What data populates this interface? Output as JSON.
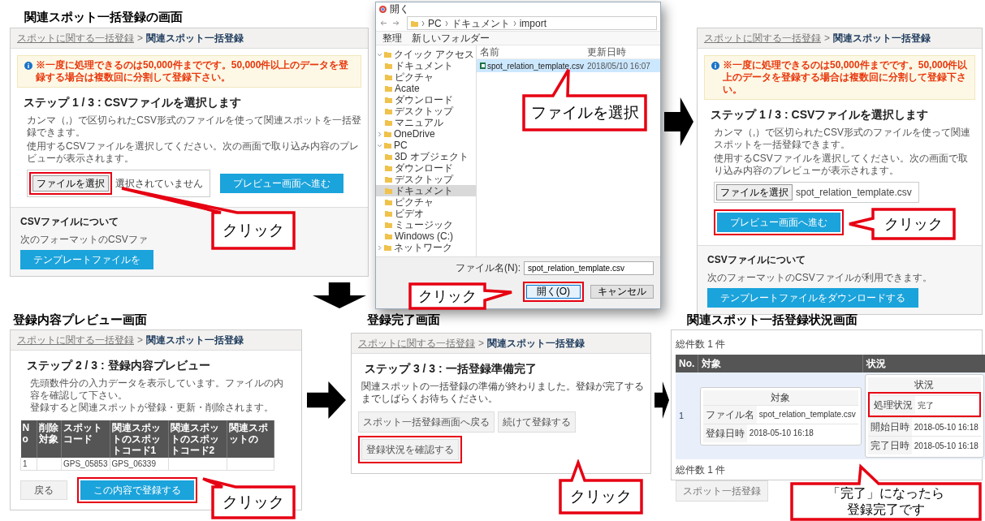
{
  "screen_select": {
    "title": "関連スポット一括登録の画面",
    "breadcrumb": {
      "parent": "スポットに関する一括登録",
      "separator": ">",
      "current": "関連スポット一括登録"
    },
    "notice": "※一度に処理できるのは50,000件までです。50,000件以上のデータを登録する場合は複数回に分割して登録下さい。",
    "heading": "ステップ 1 / 3 : CSVファイルを選択します",
    "description": [
      "カンマ（,）で区切られたCSV形式のファイルを使って関連スポットを一括登録できます。",
      "使用するCSVファイルを選択してください。次の画面で取り込み内容のプレビューが表示されます。"
    ],
    "file_button": {
      "label": "ファイルを選択",
      "highlighted": true
    },
    "file_status": "選択されていません",
    "preview_button": {
      "label": "プレビュー画面へ進む",
      "highlighted": false
    },
    "csv_section": {
      "heading": "CSVファイルについて",
      "text": "次のフォーマットのCSVファ",
      "button": "テンプレートファイルを"
    },
    "callout": "クリック"
  },
  "file_dialog": {
    "title": "開く",
    "path": [
      "PC",
      "ドキュメント",
      "import"
    ],
    "toolbar": [
      "整理",
      "新しいフォルダー"
    ],
    "sidebar": [
      {
        "label": "クイック アクセス",
        "expanded": true,
        "selected": false,
        "children": [
          {
            "label": "ドキュメント",
            "selected": false
          },
          {
            "label": "ピクチャ",
            "selected": false
          },
          {
            "label": "Acate",
            "selected": false
          },
          {
            "label": "ダウンロード",
            "selected": false
          },
          {
            "label": "デスクトップ",
            "selected": false
          },
          {
            "label": "マニュアル",
            "selected": false
          }
        ]
      },
      {
        "label": "OneDrive",
        "expanded": false,
        "selected": false
      },
      {
        "label": "PC",
        "expanded": true,
        "selected": false,
        "children": [
          {
            "label": "3D オブジェクト",
            "selected": false
          },
          {
            "label": "ダウンロード",
            "selected": false
          },
          {
            "label": "デスクトップ",
            "selected": false
          },
          {
            "label": "ドキュメント",
            "selected": true
          },
          {
            "label": "ピクチャ",
            "selected": false
          },
          {
            "label": "ビデオ",
            "selected": false
          },
          {
            "label": "ミュージック",
            "selected": false
          },
          {
            "label": "Windows (C:)",
            "selected": false
          }
        ]
      },
      {
        "label": "ネットワーク",
        "expanded": false,
        "selected": false
      }
    ],
    "columns": [
      "名前",
      "更新日時"
    ],
    "files": [
      {
        "name": "spot_relation_template.csv",
        "modified": "2018/05/10 16:07",
        "selected": true
      }
    ],
    "file_name_label": "ファイル名(N):",
    "file_name": "spot_relation_template.csv",
    "open_button": {
      "label": "開く(O)",
      "highlighted": true
    },
    "cancel_button": "キャンセル",
    "callout_select": "ファイルを選択",
    "callout_click": "クリック"
  },
  "screen_selected": {
    "breadcrumb": {
      "parent": "スポットに関する一括登録",
      "separator": ">",
      "current": "関連スポット一括登録"
    },
    "notice": "※一度に処理できるのは50,000件までです。50,000件以上のデータを登録する場合は複数回に分割して登録下さい。",
    "heading": "ステップ 1 / 3 : CSVファイルを選択します",
    "description": [
      "カンマ（,）で区切られたCSV形式のファイルを使って関連スポットを一括登録できます。",
      "使用するCSVファイルを選択してください。次の画面で取り込み内容のプレビューが表示されます。"
    ],
    "file_button": {
      "label": "ファイルを選択",
      "highlighted": false
    },
    "file_status": "spot_relation_template.csv",
    "preview_button": {
      "label": "プレビュー画面へ進む",
      "highlighted": true
    },
    "csv_section": {
      "heading": "CSVファイルについて",
      "text": "次のフォーマットのCSVファイルが利用できます。",
      "button": "テンプレートファイルをダウンロードする"
    },
    "callout": "クリック"
  },
  "screen_preview": {
    "title": "登録内容プレビュー画面",
    "breadcrumb": {
      "parent": "スポットに関する一括登録",
      "separator": ">",
      "current": "関連スポット一括登録"
    },
    "heading": "ステップ 2 / 3 : 登録内容プレビュー",
    "description": [
      "先頭数件分の入力データを表示しています。ファイルの内容を確認して下さい。",
      "登録すると関連スポットが登録・更新・削除されます。"
    ],
    "table": {
      "columns": [
        "No",
        "削除対象",
        "スポットコード",
        "関連スポットのスポットコード1",
        "関連スポットのスポットコード2",
        "関連スポットの"
      ],
      "rows": [
        {
          "no": "1",
          "spot_code": "GPS_05853",
          "related_code_1": "GPS_06339"
        }
      ]
    },
    "back_button": "戻る",
    "register_button": {
      "label": "この内容で登録する",
      "highlighted": true
    },
    "callout": "クリック"
  },
  "screen_done": {
    "title": "登録完了画面",
    "breadcrumb": {
      "parent": "スポットに関する一括登録",
      "separator": ">",
      "current": "関連スポット一括登録"
    },
    "heading": "ステップ 3 / 3 : 一括登録準備完了",
    "description": "関連スポットの一括登録の準備が終わりました。登録が完了するまでしばらくお待ちください。",
    "buttons": [
      {
        "label": "スポット一括登録画面へ戻る",
        "highlighted": false
      },
      {
        "label": "続けて登録する",
        "highlighted": false
      },
      {
        "label": "登録状況を確認する",
        "highlighted": true
      }
    ],
    "callout": "クリック"
  },
  "screen_status": {
    "title": "関連スポット一括登録状況画面",
    "total_top": "総件数 1 件",
    "columns": [
      "No.",
      "対象",
      "状況"
    ],
    "rows": [
      {
        "no": "1",
        "target": {
          "title": "対象",
          "fields": [
            {
              "label": "ファイル名",
              "value": "spot_relation_template.csv",
              "highlighted": false
            },
            {
              "label": "登録日時",
              "value": "2018-05-10 16:18",
              "highlighted": false
            }
          ]
        },
        "status": {
          "title": "状況",
          "fields": [
            {
              "label": "処理状況",
              "value": "完了",
              "highlighted": true
            },
            {
              "label": "開始日時",
              "value": "2018-05-10 16:18",
              "highlighted": false
            },
            {
              "label": "完了日時",
              "value": "2018-05-10 16:18",
              "highlighted": false
            }
          ]
        }
      }
    ],
    "total_bottom": "総件数 1 件",
    "back_button": "スポット一括登録",
    "callout": "「完了」になったら登録完了です"
  }
}
